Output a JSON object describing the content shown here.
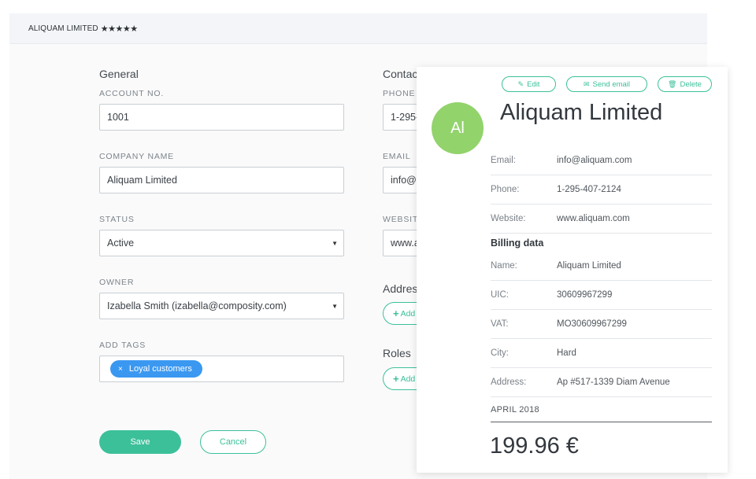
{
  "top_bar": {
    "company": "ALIQUAM LIMITED",
    "stars": "★★★★★",
    "rating": 5
  },
  "form": {
    "general_title": "General",
    "account_no_label": "ACCOUNT NO.",
    "account_no_value": "1001",
    "company_name_label": "COMPANY NAME",
    "company_name_value": "Aliquam Limited",
    "status_label": "STATUS",
    "status_value": "Active",
    "owner_label": "OWNER",
    "owner_value": "Izabella Smith (izabella@composity.com)",
    "tags_label": "ADD TAGS",
    "tag_remove": "×",
    "tag_value": "Loyal customers",
    "save_label": "Save",
    "cancel_label": "Cancel"
  },
  "contact": {
    "title": "Contac",
    "phone_label": "PHONE",
    "phone_value": "1-295-",
    "email_label": "EMAIL",
    "email_value": "info@a",
    "website_label": "WEBSIT",
    "website_value": "www.a",
    "address_title": "Addres",
    "address_add": "Add",
    "roles_title": "Roles",
    "roles_add": "Add"
  },
  "card": {
    "edit_label": "Edit",
    "send_email_label": "Send email",
    "delete_label": "Delete",
    "avatar_initials": "Al",
    "title": "Aliquam Limited",
    "rows": [
      {
        "key": "Email:",
        "value": "info@aliquam.com"
      },
      {
        "key": "Phone:",
        "value": "1-295-407-2124"
      },
      {
        "key": "Website:",
        "value": "www.aliquam.com"
      }
    ],
    "billing_title": "Billing data",
    "billing_rows": [
      {
        "key": "Name:",
        "value": "Aliquam Limited"
      },
      {
        "key": "UIC:",
        "value": "30609967299"
      },
      {
        "key": "VAT:",
        "value": "MO30609967299"
      },
      {
        "key": "City:",
        "value": "Hard"
      },
      {
        "key": "Address:",
        "value": "Ap #517-1339 Diam Avenue"
      }
    ],
    "period": "APRIL 2018",
    "amount": "199.96 €"
  },
  "colors": {
    "accent": "#3cc09a",
    "tag": "#3b98f0",
    "avatar": "#92d36b"
  }
}
